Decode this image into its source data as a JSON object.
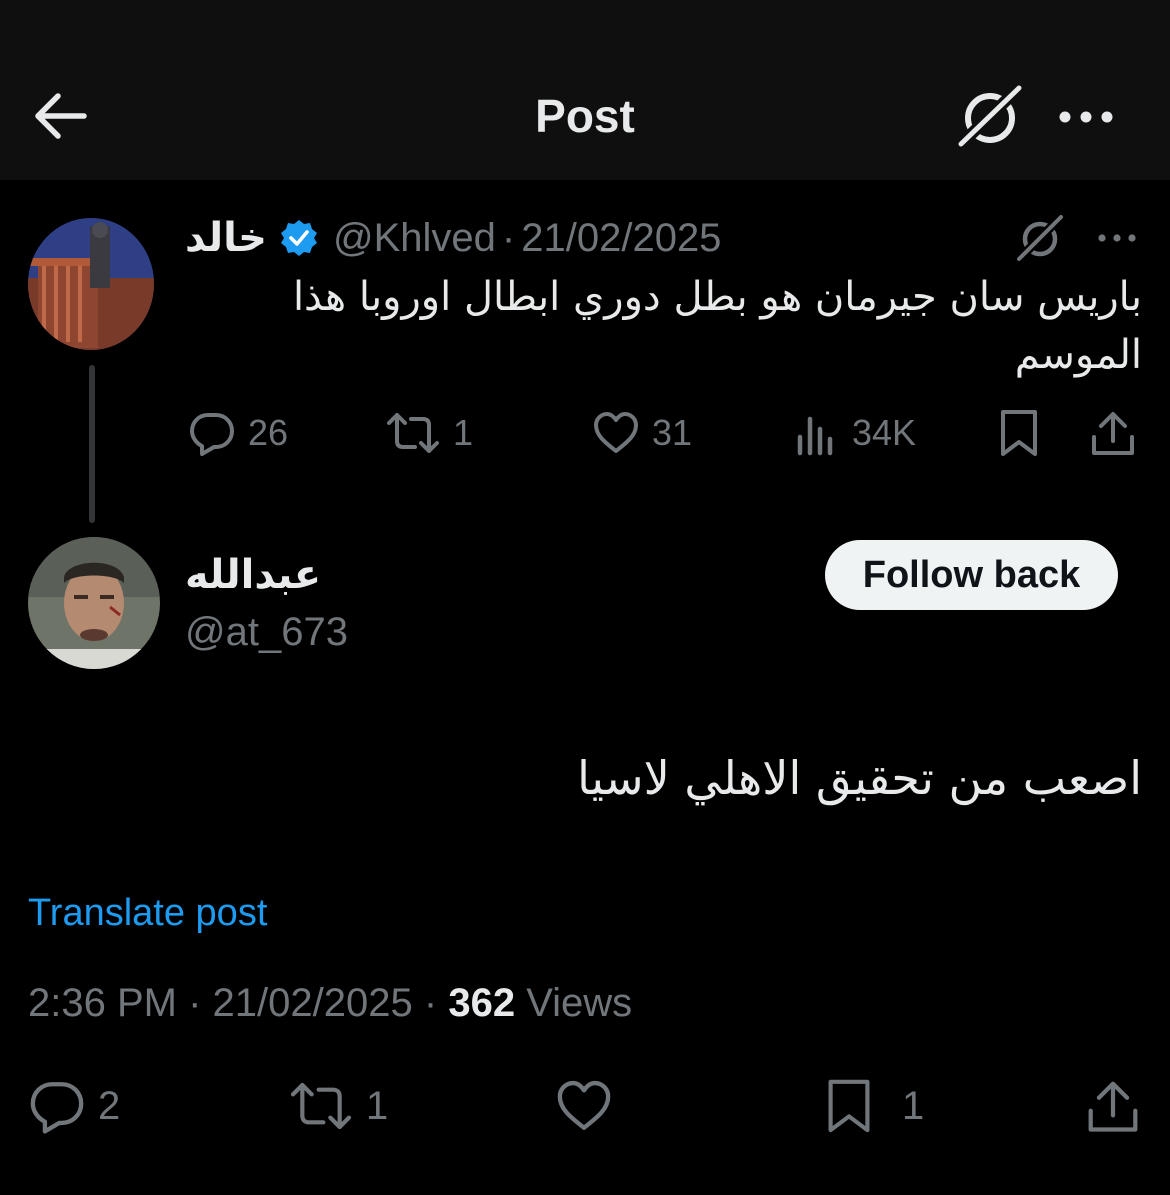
{
  "header": {
    "title": "Post",
    "icons": [
      "back-arrow-icon",
      "grok-icon",
      "more-icon"
    ]
  },
  "parent_post": {
    "author_name": "خالد",
    "verified": true,
    "handle": "@Khlved",
    "separator": "·",
    "date": "21/02/2025",
    "text": "باريس سان جيرمان هو بطل دوري ابطال اوروبا هذا الموسم",
    "stats": {
      "replies": "26",
      "reposts": "1",
      "likes": "31",
      "views": "34K"
    }
  },
  "reply_post": {
    "author_name": "عبدالله",
    "handle": "@at_673",
    "follow_label": "Follow back",
    "text": "اصعب من تحقيق الاهلي لاسيا",
    "translate_label": "Translate post",
    "time": "2:36 PM",
    "separator": "·",
    "date": "21/02/2025",
    "views_count": "362",
    "views_label": "Views",
    "stats": {
      "replies": "2",
      "reposts": "1",
      "bookmarks": "1"
    }
  },
  "colors": {
    "background": "#000000",
    "topbar": "#0f0f0f",
    "text_primary": "#e7e9ea",
    "text_secondary": "#71767b",
    "link": "#1d9bf0",
    "verified": "#1d9bf0",
    "button_bg": "#eff3f4"
  }
}
